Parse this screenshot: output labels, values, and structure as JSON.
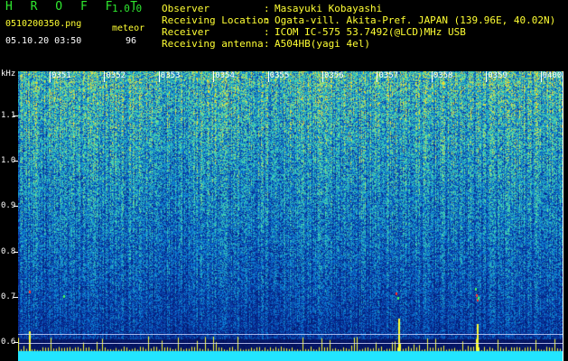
{
  "header": {
    "app_title": "H R O F F T",
    "app_version": "1.0.0",
    "file_name": "0510200350.png",
    "mode": "meteor",
    "datetime": "05.10.20 03:50",
    "count": "96"
  },
  "station": {
    "rows": [
      {
        "label": "Observer",
        "value": "Masayuki Kobayashi"
      },
      {
        "label": "Receiving Location",
        "value": "Ogata-vill. Akita-Pref. JAPAN (139.96E, 40.02N)"
      },
      {
        "label": "Receiver",
        "value": "ICOM IC-575 53.7492(@LCD)MHz USB"
      },
      {
        "label": "Receiving antenna",
        "value": "A504HB(yagi 4el)"
      }
    ]
  },
  "spectrogram": {
    "y_unit": "kHz",
    "y_ticks": [
      {
        "label": "1.1",
        "value": 1.1
      },
      {
        "label": "1.0",
        "value": 1.0
      },
      {
        "label": "0.9",
        "value": 0.9
      },
      {
        "label": "0.8",
        "value": 0.8
      },
      {
        "label": "0.7",
        "value": 0.7
      },
      {
        "label": "0.6",
        "value": 0.6
      }
    ],
    "x_ticks": [
      "0351",
      "0352",
      "0353",
      "0354",
      "0355",
      "0356",
      "0357",
      "0358",
      "0359",
      "0400"
    ],
    "colors": {
      "background": "#000000",
      "noise_low": "#0a1a8a",
      "noise_mid": "#1e5bd0",
      "noise_high": "#2fd0c8",
      "signal": "#ffff33",
      "baseline": "#22e5ff"
    }
  }
}
